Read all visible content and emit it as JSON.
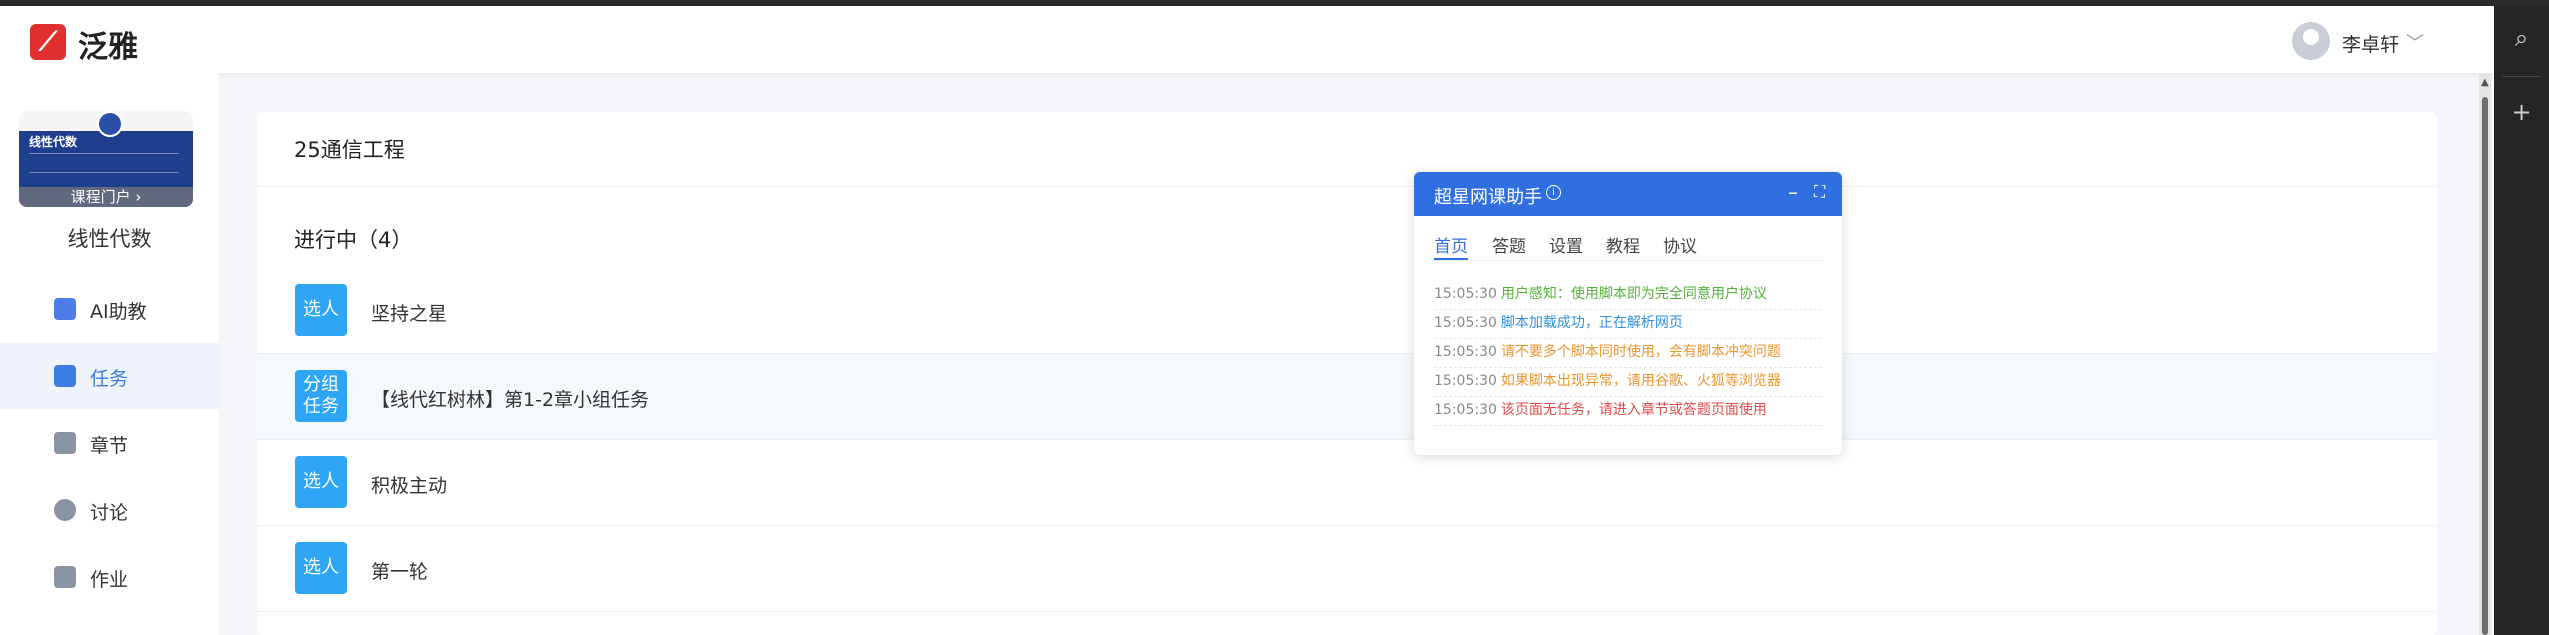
{
  "header": {
    "brand": "泛雅",
    "user_name": "李卓轩",
    "caret": "﹀"
  },
  "sidebar": {
    "cover_title": "线性代数",
    "cover_button": "课程门户 ›",
    "course_name": "线性代数",
    "items": [
      {
        "label": "AI助教",
        "icon": "ai-icon"
      },
      {
        "label": "任务",
        "icon": "grid-icon"
      },
      {
        "label": "章节",
        "icon": "chapter-icon"
      },
      {
        "label": "讨论",
        "icon": "chat-icon"
      },
      {
        "label": "作业",
        "icon": "homework-icon"
      }
    ]
  },
  "main": {
    "class_title": "25通信工程",
    "section_title": "进行中（4）",
    "tasks": [
      {
        "badge": "选人",
        "name": "坚持之星"
      },
      {
        "badge": "分组任务",
        "name": "【线代红树林】第1-2章小组任务"
      },
      {
        "badge": "选人",
        "name": "积极主动"
      },
      {
        "badge": "选人",
        "name": "第一轮"
      }
    ]
  },
  "helper": {
    "title": "超星网课助手",
    "tabs": [
      "首页",
      "答题",
      "设置",
      "教程",
      "协议"
    ],
    "logs": [
      {
        "time": "15:05:30",
        "text": "用户感知：使用脚本即为完全同意用户协议",
        "color": "#52b33a"
      },
      {
        "time": "15:05:30",
        "text": "脚本加载成功，正在解析网页",
        "color": "#2f8fe0"
      },
      {
        "time": "15:05:30",
        "text": "请不要多个脚本同时使用，会有脚本冲突问题",
        "color": "#e8962e"
      },
      {
        "time": "15:05:30",
        "text": "如果脚本出现异常，请用谷歌、火狐等浏览器",
        "color": "#e8962e"
      },
      {
        "time": "15:05:30",
        "text": "该页面无任务，请进入章节或答题页面使用",
        "color": "#e04a4a"
      }
    ]
  },
  "colors": {
    "accent": "#2f6fe0",
    "badge": "#2ea6f5",
    "logo": "#e02f2f"
  }
}
